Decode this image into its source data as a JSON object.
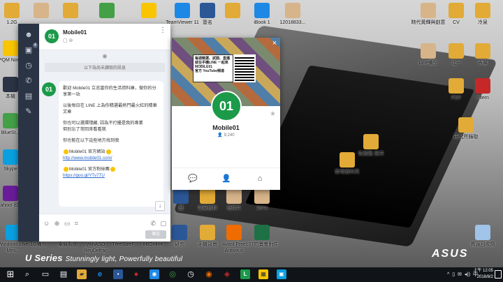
{
  "desktop": {
    "icons_top": [
      {
        "label": "1.2G",
        "color": "#e2aa36"
      },
      {
        "label": "",
        "color": "#d7b48a"
      },
      {
        "label": "",
        "color": "#e2aa36"
      },
      {
        "label": "",
        "color": "#43a047"
      },
      {
        "label": "",
        "color": "#f9c400"
      },
      {
        "label": "TeamViewer 11",
        "color": "#1e88e5"
      },
      {
        "label": "簽名",
        "color": "#2b5797"
      },
      {
        "label": "",
        "color": "#e2aa36"
      },
      {
        "label": "iBook 1",
        "color": "#1e88e5"
      },
      {
        "label": "12018833...",
        "color": "#d7b48a"
      },
      {
        "label": "時代黃輝與創意",
        "color": "#d7b48a"
      },
      {
        "label": "CV",
        "color": "#e2aa36"
      },
      {
        "label": "冷泉",
        "color": "#e2aa36"
      }
    ],
    "icons_left": [
      {
        "label": "PQM Nova",
        "color": "#f9c400"
      },
      {
        "label": "本機",
        "color": "#2b3444"
      },
      {
        "label": "BlueSt...",
        "color": "#43a047"
      },
      {
        "label": "Skype",
        "color": "#0aa0e0"
      },
      {
        "label": "Yahoo! 即時",
        "color": "#6a1b9a"
      }
    ],
    "icons_right": [
      {
        "label": "Line備份",
        "color": "#d7b48a"
      },
      {
        "label": "北一",
        "color": "#e2aa36"
      },
      {
        "label": "表單",
        "color": "#e2aa36"
      },
      {
        "label": "PDF",
        "color": "#e2aa36"
      },
      {
        "label": "Intern",
        "color": "#c62828"
      },
      {
        "label": "研究所錄取",
        "color": "#e2aa36"
      },
      {
        "label": "佐賀縣 東洋",
        "color": "#e2aa36"
      },
      {
        "label": "新增資料夾",
        "color": "#e2aa36"
      },
      {
        "label": "資源回收筒",
        "color": "#9fc4e8"
      }
    ],
    "icons_bottom": [
      {
        "label": "Windows Live Mes...",
        "color": "#0aa0e0"
      },
      {
        "label": "1G備份",
        "color": "#e2aa36"
      },
      {
        "label": "電競製圖",
        "color": "#2b5797"
      },
      {
        "label": "WinASO RegDefrag",
        "color": "#1e88e5"
      },
      {
        "label": "TreeSizeF...",
        "color": "#43a047"
      },
      {
        "label": "8BOnline",
        "color": "#e2aa36"
      },
      {
        "label": "研究",
        "color": "#2b5797"
      },
      {
        "label": "圖",
        "color": "#2b5797"
      },
      {
        "label": "專案資料",
        "color": "#e2aa36"
      },
      {
        "label": "哥伴片",
        "color": "#d7b48a"
      },
      {
        "label": "2874",
        "color": "#d7b48a"
      },
      {
        "label": "手機背景",
        "color": "#e2aa36"
      },
      {
        "label": "Avast Free Antivirus",
        "color": "#ef6c00"
      },
      {
        "label": "107拍賣會附件",
        "color": "#1e7145"
      }
    ],
    "wallpaper": {
      "series": "U Series",
      "tagline": "Stunningly light, Powerfully beautiful",
      "brand": "ASUS"
    }
  },
  "line": {
    "sidebar_badge": "4",
    "chat_name": "Mobile01",
    "sys_notice": "以下為尚未讀取的訊息",
    "messages": {
      "p1": "歡迎 Mobile01 立志當你的生活資料庫，做你的分享第一站",
      "p2": "以後每日在 LINE 上為你精選最熱門最火紅的精華文章",
      "p3": "你也可以選擇隱藏, 因為不打擾是我的專業",
      "p3b": "但別忘了常回來看看我",
      "p4": "你也能在以下這些地方找到我",
      "site_label": "Mobile01 官方網站",
      "site_url": "http://www.mobile01.com/",
      "fb_label": "Mobile01 官方粉絲團",
      "fb_url": "https://goo.gl/YTv7TU"
    },
    "send_label": "傳送"
  },
  "profile": {
    "name": "Mobile01",
    "followers": "9,240",
    "cover_promo": "每週精選、試開、直播 就在手機LINE 一起來",
    "cover_brand": "MOBILE01",
    "cover_footer": "官方 YouTube頻道"
  },
  "taskbar": {
    "time": "上午 12:05",
    "date": "2018/8/2",
    "ime": "中",
    "tray": "^ ▯ ✉ ◂))"
  }
}
